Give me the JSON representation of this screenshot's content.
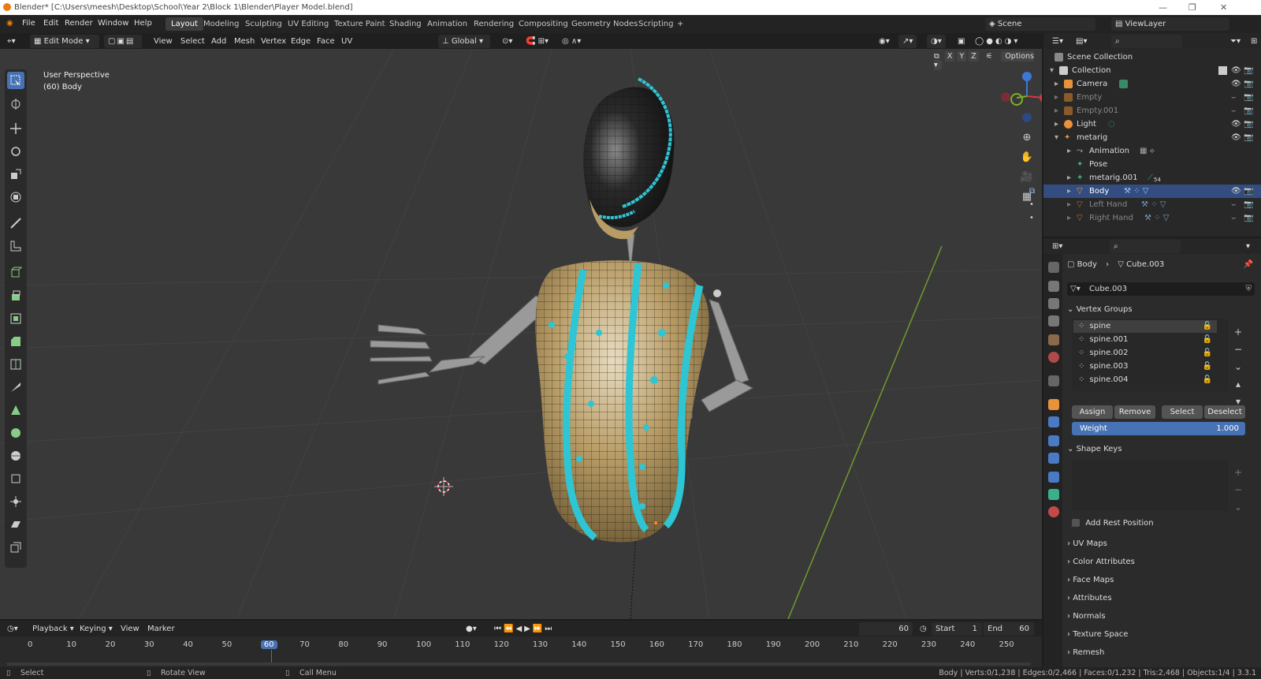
{
  "window": {
    "title": "Blender* [C:\\Users\\meesh\\Desktop\\School\\Year 2\\Block 1\\Blender\\Player Model.blend]"
  },
  "menus": [
    "File",
    "Edit",
    "Render",
    "Window",
    "Help"
  ],
  "workspaces": [
    "Layout",
    "Modeling",
    "Sculpting",
    "UV Editing",
    "Texture Paint",
    "Shading",
    "Animation",
    "Rendering",
    "Compositing",
    "Geometry Nodes",
    "Scripting",
    "+"
  ],
  "scene": {
    "scene_label": "Scene",
    "viewlayer_label": "ViewLayer"
  },
  "viewport_header": {
    "mode": "Edit Mode",
    "menus": [
      "View",
      "Select",
      "Add",
      "Mesh",
      "Vertex",
      "Edge",
      "Face",
      "UV"
    ],
    "transform": "Global",
    "axes": [
      "X",
      "Y",
      "Z"
    ],
    "options": "Options"
  },
  "viewport": {
    "perspective": "User Perspective",
    "object_info": "(60) Body"
  },
  "outliner": {
    "rows": [
      {
        "label": "Scene Collection",
        "indent": 0
      },
      {
        "label": "Collection",
        "indent": 1
      },
      {
        "label": "Camera",
        "indent": 2
      },
      {
        "label": "Empty",
        "indent": 2,
        "dim": true
      },
      {
        "label": "Empty.001",
        "indent": 2,
        "dim": true
      },
      {
        "label": "Light",
        "indent": 2
      },
      {
        "label": "metarig",
        "indent": 2
      },
      {
        "label": "Animation",
        "indent": 3
      },
      {
        "label": "Pose",
        "indent": 3
      },
      {
        "label": "metarig.001",
        "indent": 3
      },
      {
        "label": "Body",
        "indent": 3,
        "selected": true
      },
      {
        "label": "Left Hand",
        "indent": 3,
        "dim": true
      },
      {
        "label": "Right Hand",
        "indent": 3,
        "dim": true
      }
    ],
    "badge": "54"
  },
  "properties": {
    "breadcrumb_object": "Body",
    "breadcrumb_mesh": "Cube.003",
    "mesh_name": "Cube.003",
    "vertex_groups_title": "Vertex Groups",
    "vertex_groups": [
      "spine",
      "spine.001",
      "spine.002",
      "spine.003",
      "spine.004"
    ],
    "buttons": [
      "Assign",
      "Remove",
      "Select",
      "Deselect"
    ],
    "weight_label": "Weight",
    "weight_value": "1.000",
    "shape_keys_title": "Shape Keys",
    "add_rest_position": "Add Rest Position",
    "sections": [
      "UV Maps",
      "Color Attributes",
      "Face Maps",
      "Attributes",
      "Normals",
      "Texture Space",
      "Remesh"
    ]
  },
  "timeline": {
    "menus": [
      "Playback",
      "Keying",
      "View",
      "Marker"
    ],
    "current_frame": "60",
    "start_label": "Start",
    "start": "1",
    "end_label": "End",
    "end": "60",
    "ticks": [
      "0",
      "10",
      "20",
      "30",
      "40",
      "50",
      "60",
      "70",
      "80",
      "90",
      "100",
      "110",
      "120",
      "130",
      "140",
      "150",
      "160",
      "170",
      "180",
      "190",
      "200",
      "210",
      "220",
      "230",
      "240",
      "250"
    ]
  },
  "status": {
    "left": "Select",
    "middle": "Rotate View",
    "right": "Call Menu",
    "stats": "Body | Verts:0/1,238 | Edges:0/2,466 | Faces:0/1,232 | Tris:2,468 | Objects:1/4 | 3.3.1"
  },
  "colors": {
    "accent": "#4772b3",
    "selection": "#334d80",
    "seam": "#2ec6d4",
    "mesh": "#c8b07a",
    "grid_green": "#6f9a2e"
  }
}
